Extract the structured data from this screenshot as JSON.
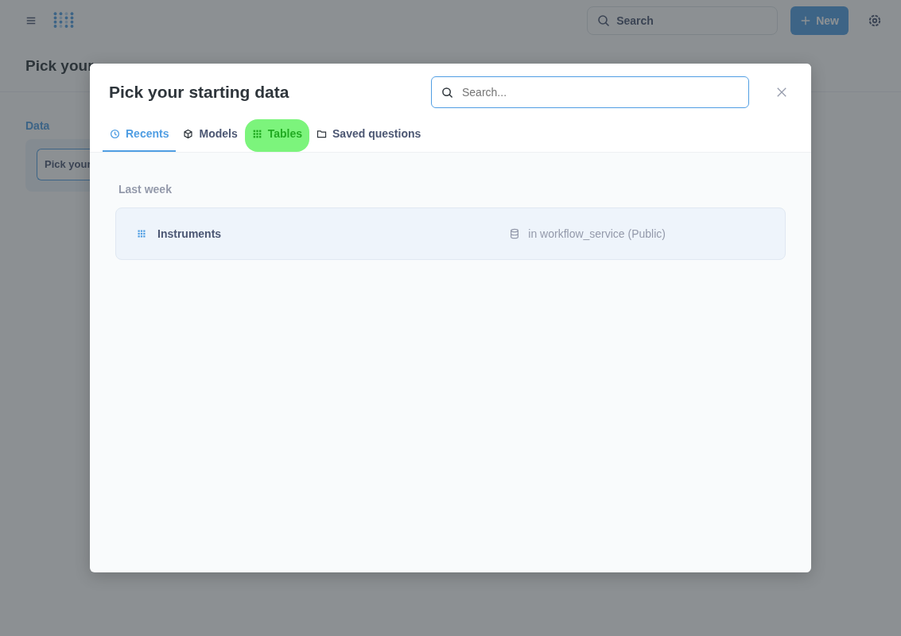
{
  "app_bar": {
    "search_placeholder": "Search",
    "new_button": "New"
  },
  "page": {
    "title": "Pick your",
    "section_label": "Data",
    "picker_button": "Pick your"
  },
  "modal": {
    "title": "Pick your starting data",
    "search": {
      "placeholder": "Search..."
    },
    "tabs": [
      {
        "label": "Recents",
        "kind": "clock",
        "selected": true,
        "highlighted": false
      },
      {
        "label": "Models",
        "kind": "cube",
        "selected": false,
        "highlighted": false
      },
      {
        "label": "Tables",
        "kind": "grid",
        "selected": false,
        "highlighted": true
      },
      {
        "label": "Saved questions",
        "kind": "folder",
        "selected": false,
        "highlighted": false
      }
    ],
    "groups": [
      {
        "heading": "Last week",
        "items": [
          {
            "name": "Instruments",
            "location": "in workflow_service (Public)"
          }
        ]
      }
    ]
  }
}
